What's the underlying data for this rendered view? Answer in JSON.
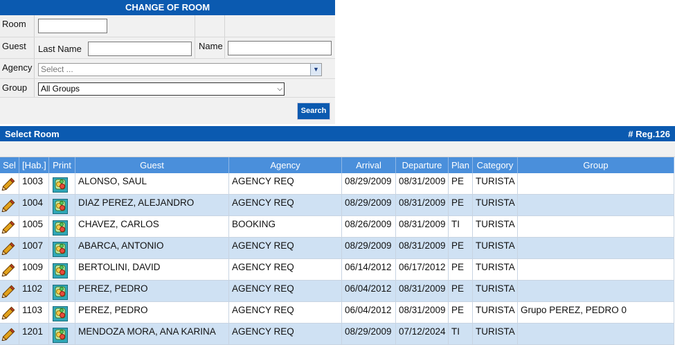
{
  "form": {
    "title": "CHANGE OF ROOM",
    "room_label": "Room",
    "room_value": "",
    "guest_label": "Guest",
    "last_name_label": "Last Name",
    "last_name_value": "",
    "name_label": "Name",
    "name_value": "",
    "agency_label": "Agency",
    "agency_placeholder": "Select ...",
    "group_label": "Group",
    "group_selected": "All Groups",
    "search_label": "Search"
  },
  "results": {
    "title": "Select Room",
    "reg_count": "# Reg.126",
    "columns": [
      "Sel",
      "[Hab.]",
      "Print",
      "Guest",
      "Agency",
      "Arrival",
      "Departure",
      "Plan",
      "Category",
      "Group"
    ],
    "rows": [
      {
        "room": "1003",
        "guest": "ALONSO, SAUL",
        "agency": "AGENCY REQ",
        "arrival": "08/29/2009",
        "departure": "08/31/2009",
        "plan": "PE",
        "category": "TURISTA",
        "group": ""
      },
      {
        "room": "1004",
        "guest": "DIAZ PEREZ, ALEJANDRO",
        "agency": "AGENCY REQ",
        "arrival": "08/29/2009",
        "departure": "08/31/2009",
        "plan": "PE",
        "category": "TURISTA",
        "group": ""
      },
      {
        "room": "1005",
        "guest": "CHAVEZ, CARLOS",
        "agency": "BOOKING",
        "arrival": "08/26/2009",
        "departure": "08/31/2009",
        "plan": "TI",
        "category": "TURISTA",
        "group": ""
      },
      {
        "room": "1007",
        "guest": "ABARCA, ANTONIO",
        "agency": "AGENCY REQ",
        "arrival": "08/29/2009",
        "departure": "08/31/2009",
        "plan": "PE",
        "category": "TURISTA",
        "group": ""
      },
      {
        "room": "1009",
        "guest": "BERTOLINI, DAVID",
        "agency": "AGENCY REQ",
        "arrival": "06/14/2012",
        "departure": "06/17/2012",
        "plan": "PE",
        "category": "TURISTA",
        "group": ""
      },
      {
        "room": "1102",
        "guest": "PEREZ, PEDRO",
        "agency": "AGENCY REQ",
        "arrival": "06/04/2012",
        "departure": "08/31/2009",
        "plan": "PE",
        "category": "TURISTA",
        "group": ""
      },
      {
        "room": "1103",
        "guest": "PEREZ, PEDRO",
        "agency": "AGENCY REQ",
        "arrival": "06/04/2012",
        "departure": "08/31/2009",
        "plan": "PE",
        "category": "TURISTA",
        "group": "Grupo PEREZ, PEDRO 0"
      },
      {
        "room": "1201",
        "guest": "MENDOZA MORA, ANA KARINA",
        "agency": "AGENCY REQ",
        "arrival": "08/29/2009",
        "departure": "07/12/2024",
        "plan": "TI",
        "category": "TURISTA",
        "group": ""
      }
    ]
  },
  "icons": {
    "select": "pencil-icon",
    "print": "print-icon"
  },
  "colors": {
    "header_blue": "#0b5ab0",
    "table_header": "#4a8fdb",
    "row_alt": "#cfe1f3"
  }
}
